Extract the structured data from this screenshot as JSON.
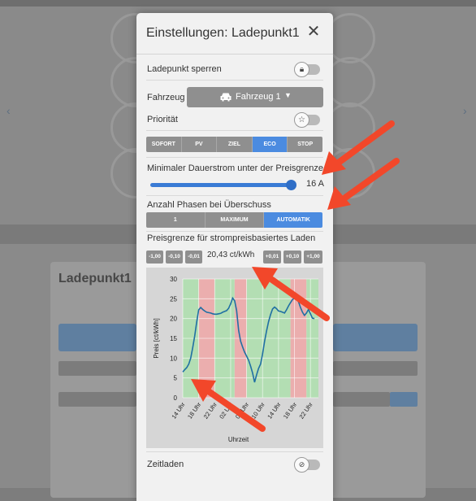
{
  "background": {
    "card_title": "Ladepunkt1"
  },
  "dialog": {
    "title_prefix": "Einstellungen:",
    "title_name": "Ladepunkt1",
    "close_icon": "close-icon",
    "lock": {
      "label": "Ladepunkt sperren",
      "icon": "lock-icon",
      "enabled": false
    },
    "vehicle": {
      "label": "Fahrzeug",
      "selected": "Fahrzeug 1",
      "icon": "car-icon"
    },
    "priority": {
      "label": "Priorität",
      "icon": "star-icon",
      "enabled": false
    },
    "modes": {
      "options": [
        "SOFORT",
        "PV",
        "ZIEL",
        "ECO",
        "STOP"
      ],
      "selected": "ECO"
    },
    "min_current": {
      "label": "Minimaler Dauerstrom unter der Preisgrenze",
      "value_text": "16 A",
      "fraction": 1.0
    },
    "phases": {
      "label": "Anzahl Phasen bei Überschuss",
      "options": [
        "1",
        "MAXIMUM",
        "AUTOMATIK"
      ],
      "selected": "AUTOMATIK"
    },
    "price_limit": {
      "label": "Preisgrenze für strompreisbasiertes Laden",
      "minus_buttons": [
        "-1,00",
        "-0,10",
        "-0,01"
      ],
      "plus_buttons": [
        "+0,01",
        "+0,10",
        "+1,00"
      ],
      "value_text": "20,43 ct/kWh"
    },
    "timed_charging": {
      "label": "Zeitladen",
      "icon": "clock-off-icon",
      "enabled": false
    }
  },
  "chart_data": {
    "type": "line",
    "ylabel": "Preis [ct/kWh]",
    "xlabel": "Uhrzeit",
    "ylim": [
      0,
      30
    ],
    "yticks": [
      0,
      5,
      10,
      15,
      20,
      25,
      30
    ],
    "xtick_labels": [
      "14 Uhr",
      "18 Uhr",
      "22 Uhr",
      "02 Uhr",
      "06 Uhr",
      "10 Uhr",
      "14 Uhr",
      "18 Uhr",
      "22 Uhr"
    ],
    "x_hours_from_start": [
      0,
      4,
      8,
      12,
      16,
      20,
      24,
      28,
      32
    ],
    "x_range_hours": [
      0,
      34
    ],
    "price_limit": 20.43,
    "colors": {
      "line": "#1f6fa3",
      "below_limit": "#a6d8a6",
      "above_limit": "#e8a0a0"
    },
    "series": [
      {
        "x": [
          0,
          0.5,
          1,
          1.5,
          2,
          2.5,
          3,
          3.5,
          4,
          4.5,
          5,
          5.5,
          6,
          6.5,
          7,
          7.5,
          8,
          8.5,
          9,
          9.5,
          10,
          10.5,
          11,
          11.5,
          12,
          12.5,
          13,
          13.5,
          14,
          14.5,
          15,
          15.5,
          16,
          16.5,
          17,
          17.5,
          18,
          18.5,
          19,
          19.5,
          20,
          20.5,
          21,
          21.5,
          22,
          22.5,
          23,
          23.5,
          24,
          24.5,
          25,
          25.5,
          26,
          26.5,
          27,
          27.5,
          28,
          28.5,
          29,
          29.5,
          30,
          30.5,
          31,
          31.5,
          32,
          32.5,
          33
        ],
        "values": [
          6.5,
          7.1,
          7.6,
          8.5,
          10.0,
          12.7,
          15.6,
          19.2,
          22.2,
          22.8,
          22.3,
          21.9,
          21.6,
          21.5,
          21.4,
          21.2,
          21.1,
          21.1,
          21.2,
          21.3,
          21.6,
          21.8,
          22.0,
          22.6,
          23.7,
          25.2,
          24.5,
          22.0,
          17.0,
          14.3,
          12.8,
          11.5,
          10.5,
          9.5,
          8.0,
          6.2,
          3.9,
          5.8,
          7.4,
          8.5,
          11.0,
          14.2,
          16.8,
          19.2,
          21.0,
          22.4,
          22.9,
          22.5,
          21.9,
          21.8,
          21.6,
          21.4,
          22.2,
          23.2,
          24.0,
          24.8,
          25.2,
          24.9,
          24.3,
          22.8,
          21.6,
          20.8,
          21.4,
          22.3,
          21.2,
          20.1,
          20.0
        ]
      }
    ],
    "shaded_bands": [
      {
        "from": 0,
        "to": 4,
        "state": "below_limit"
      },
      {
        "from": 4,
        "to": 8,
        "state": "above_limit"
      },
      {
        "from": 8,
        "to": 13,
        "state": "below_limit"
      },
      {
        "from": 13,
        "to": 16,
        "state": "above_limit"
      },
      {
        "from": 16,
        "to": 27,
        "state": "below_limit"
      },
      {
        "from": 27,
        "to": 31,
        "state": "above_limit"
      },
      {
        "from": 31,
        "to": 34,
        "state": "below_limit"
      }
    ]
  }
}
